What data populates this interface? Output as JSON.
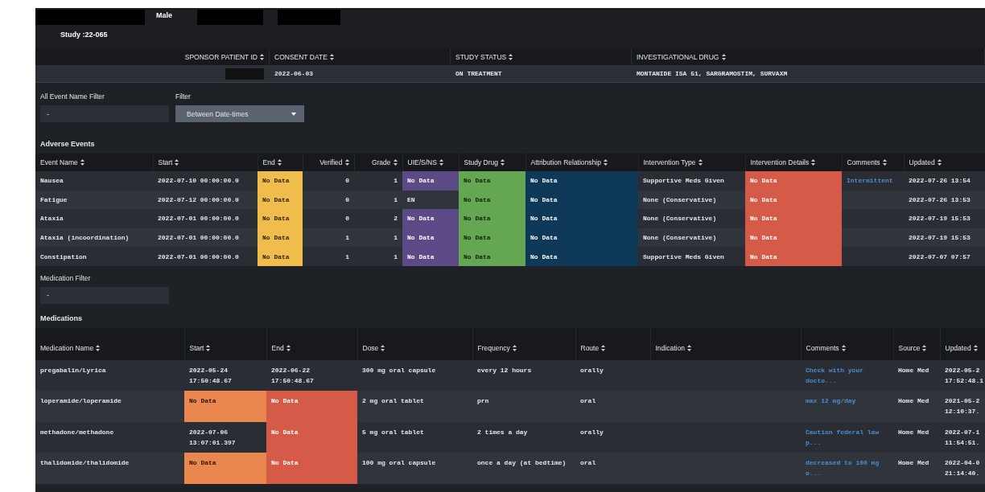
{
  "patient_header": {
    "sex": "Male",
    "study": "Study :22-065"
  },
  "summary": {
    "columns": [
      {
        "header": "SPONSOR PATIENT ID",
        "redacted": true
      },
      {
        "header": "CONSENT DATE",
        "redacted": false,
        "value": "2022-06-03"
      },
      {
        "header": "STUDY STATUS",
        "redacted": false,
        "value": "ON TREATMENT"
      },
      {
        "header": "INVESTIGATIONAL DRUG",
        "redacted": false,
        "value": "MONTANIDE ISA 51, SARGRAMOSTIM, SURVAXM"
      }
    ]
  },
  "event_filters": [
    {
      "kind": "text",
      "label": "All Event Name Filter",
      "value": "-"
    },
    {
      "kind": "dropdown",
      "label": "Filter",
      "value": "Between Date-times"
    }
  ],
  "adverse_events": {
    "title": "Adverse Events",
    "columns": [
      {
        "label": "Event Name"
      },
      {
        "label": "Start"
      },
      {
        "label": "End"
      },
      {
        "label": "Verified"
      },
      {
        "label": "Grade"
      },
      {
        "label": "UIE/S/NS"
      },
      {
        "label": "Study Drug"
      },
      {
        "label": "Attribution Relationship"
      },
      {
        "label": "Intervention Type"
      },
      {
        "label": "Intervention Details"
      },
      {
        "label": "Comments"
      },
      {
        "label": "Updated"
      }
    ],
    "rows": [
      {
        "cells": [
          {
            "text": "Nausea"
          },
          {
            "text": "2022-07-10 00:00:00.0"
          },
          {
            "text": "No Data",
            "color": "#f0bd4c"
          },
          {
            "text": "0"
          },
          {
            "text": "1"
          },
          {
            "text": "No Data",
            "color": "#5c4a86"
          },
          {
            "text": "No Data",
            "color": "#64a651"
          },
          {
            "text": "No Data",
            "color": "#0e3858"
          },
          {
            "text": "Supportive Meds Given"
          },
          {
            "text": "No Data",
            "color": "#d65a48"
          },
          {
            "text": "Intermittent",
            "kind": "link"
          },
          {
            "text": "2022-07-26 13:54"
          }
        ]
      },
      {
        "cells": [
          {
            "text": "Fatigue"
          },
          {
            "text": "2022-07-12 00:00:00.0"
          },
          {
            "text": "No Data",
            "color": "#f0bd4c"
          },
          {
            "text": "0"
          },
          {
            "text": "1"
          },
          {
            "text": "EN"
          },
          {
            "text": "No Data",
            "color": "#64a651"
          },
          {
            "text": "No Data",
            "color": "#0e3858"
          },
          {
            "text": "None (Conservative)"
          },
          {
            "text": "No Data",
            "color": "#d65a48"
          },
          {},
          {
            "text": "2022-07-26 13:53"
          }
        ]
      },
      {
        "cells": [
          {
            "text": "Ataxia"
          },
          {
            "text": "2022-07-01 00:00:00.0"
          },
          {
            "text": "No Data",
            "color": "#f0bd4c"
          },
          {
            "text": "0"
          },
          {
            "text": "2"
          },
          {
            "text": "No Data",
            "color": "#5c4a86"
          },
          {
            "text": "No Data",
            "color": "#64a651"
          },
          {
            "text": "No Data",
            "color": "#0e3858"
          },
          {
            "text": "None (Conservative)"
          },
          {
            "text": "No Data",
            "color": "#d65a48"
          },
          {},
          {
            "text": "2022-07-19 15:53"
          }
        ]
      },
      {
        "cells": [
          {
            "text": "Ataxia (incoordination)"
          },
          {
            "text": "2022-07-01 00:00:00.0"
          },
          {
            "text": "No Data",
            "color": "#f0bd4c"
          },
          {
            "text": "1"
          },
          {
            "text": "1"
          },
          {
            "text": "No Data",
            "color": "#5c4a86"
          },
          {
            "text": "No Data",
            "color": "#64a651"
          },
          {
            "text": "No Data",
            "color": "#0e3858"
          },
          {
            "text": "None (Conservative)"
          },
          {
            "text": "No Data",
            "color": "#d65a48"
          },
          {},
          {
            "text": "2022-07-19 15:53"
          }
        ]
      },
      {
        "cells": [
          {
            "text": "Constipation"
          },
          {
            "text": "2022-07-01 00:00:00.0"
          },
          {
            "text": "No Data",
            "color": "#f0bd4c"
          },
          {
            "text": "1"
          },
          {
            "text": "1"
          },
          {
            "text": "No Data",
            "color": "#5c4a86"
          },
          {
            "text": "No Data",
            "color": "#64a651"
          },
          {
            "text": "No Data",
            "color": "#0e3858"
          },
          {
            "text": "Supportive Meds Given"
          },
          {
            "text": "No Data",
            "color": "#d65a48"
          },
          {},
          {
            "text": "2022-07-07 07:57"
          }
        ]
      }
    ]
  },
  "medication_filter": {
    "kind": "text",
    "label": "Medication Filter",
    "value": "-"
  },
  "medications": {
    "title": "Medications",
    "columns": [
      {
        "label": "Medication Name"
      },
      {
        "label": "Start"
      },
      {
        "label": "End"
      },
      {
        "label": "Dose"
      },
      {
        "label": "Frequency"
      },
      {
        "label": "Route"
      },
      {
        "label": "Indication"
      },
      {
        "label": "Comments"
      },
      {
        "label": "Source"
      },
      {
        "label": "Updated"
      }
    ],
    "rows": [
      {
        "cells": [
          {
            "text": "pregabalin/Lyrica"
          },
          {
            "text": "2022-05-24 17:50:48.67"
          },
          {
            "text": "2022-06-22 17:50:48.67"
          },
          {
            "text": "300 mg oral capsule"
          },
          {
            "text": "every 12 hours"
          },
          {
            "text": "orally"
          },
          {},
          {
            "text": "Check with your docto...",
            "kind": "link"
          },
          {
            "text": "Home Med"
          },
          {
            "text": "2022-05-2 17:52:48.1"
          }
        ]
      },
      {
        "cells": [
          {
            "text": "loperamide/loperamide"
          },
          {
            "text": "No Data",
            "color": "#e9874f"
          },
          {
            "text": "No Data",
            "color": "#d65a48"
          },
          {
            "text": "2 mg oral tablet"
          },
          {
            "text": "prn"
          },
          {
            "text": "oral"
          },
          {},
          {
            "text": "max 12 mg/day",
            "kind": "link"
          },
          {
            "text": "Home Med"
          },
          {
            "text": "2021-05-2 12:10:37."
          }
        ]
      },
      {
        "cells": [
          {
            "text": "methadone/methadone"
          },
          {
            "text": "2022-07-06 13:07:01.397"
          },
          {
            "text": "No Data",
            "color": "#d65a48"
          },
          {
            "text": "5 mg oral tablet"
          },
          {
            "text": "2 times a day"
          },
          {
            "text": "orally"
          },
          {},
          {
            "text": "Caution federal law p...",
            "kind": "link"
          },
          {
            "text": "Home Med"
          },
          {
            "text": "2022-07-1 11:54:51."
          }
        ]
      },
      {
        "cells": [
          {
            "text": "thalidomide/thalidomide"
          },
          {
            "text": "No Data",
            "color": "#e9874f"
          },
          {
            "text": "No Data",
            "color": "#d65a48"
          },
          {
            "text": "100 mg oral capsule"
          },
          {
            "text": "once a day (at bedtime)"
          },
          {
            "text": "oral"
          },
          {},
          {
            "text": "decreased to 100 mg o...",
            "kind": "link"
          },
          {
            "text": "Home Med"
          },
          {
            "text": "2022-04-0 21:14:40."
          }
        ]
      }
    ]
  }
}
